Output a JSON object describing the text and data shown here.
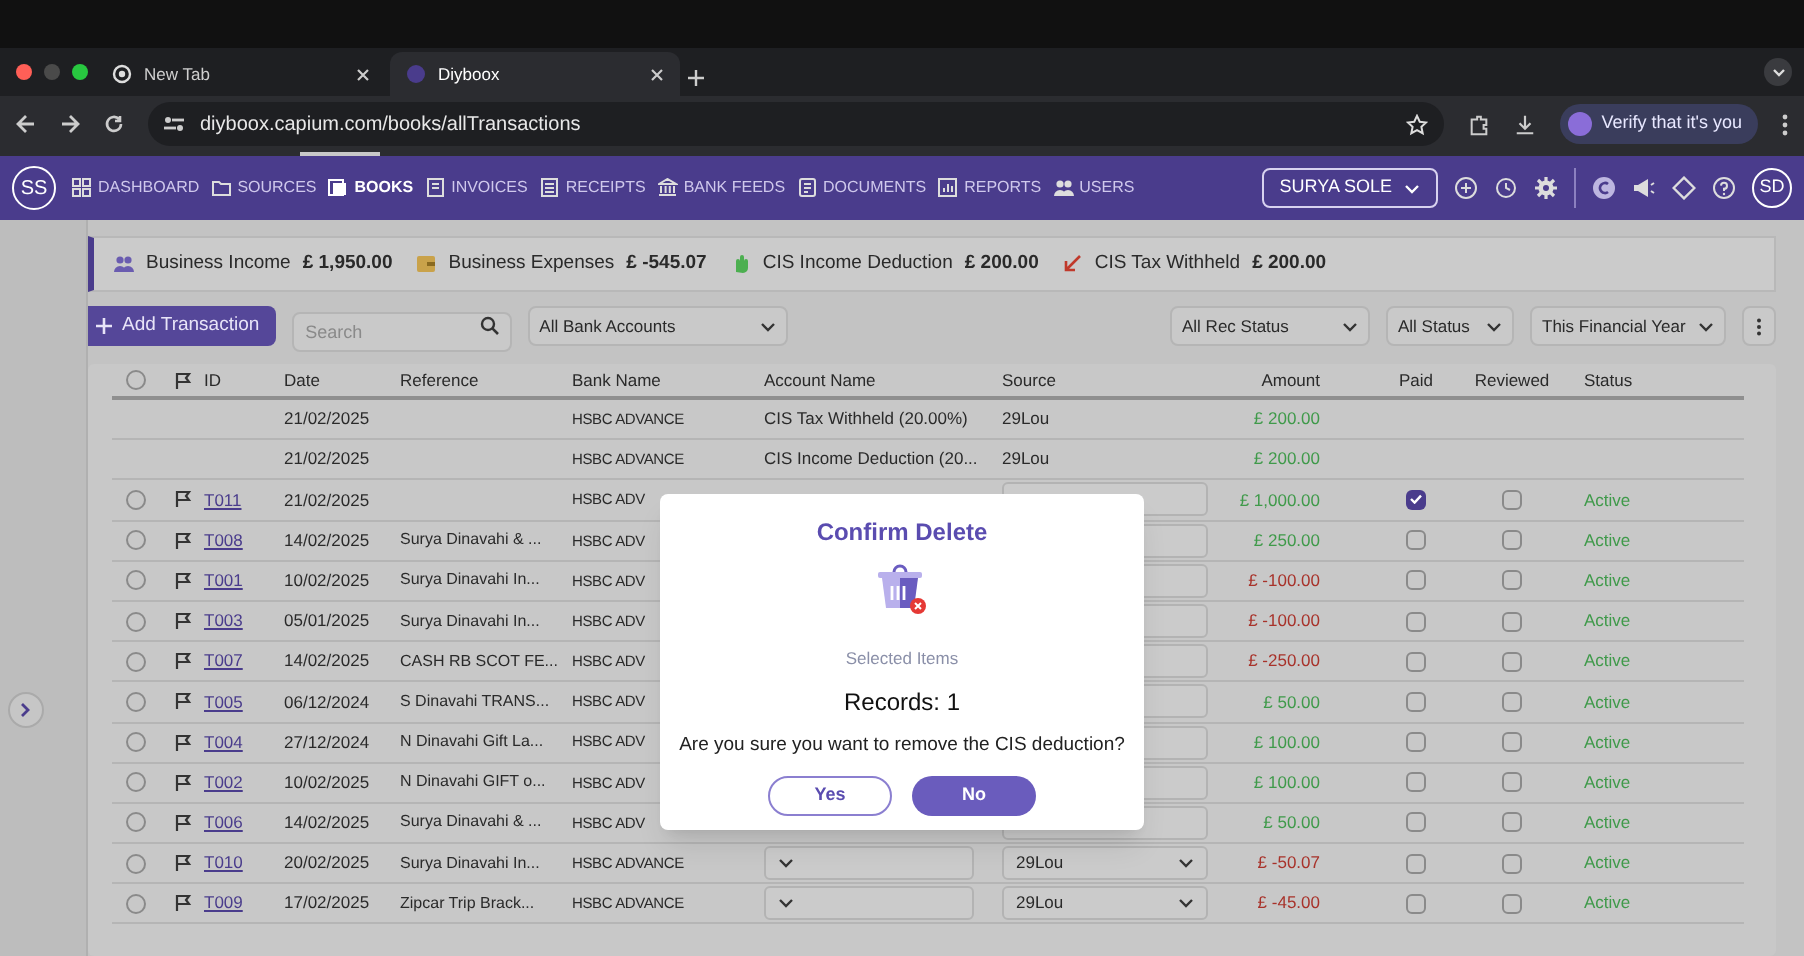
{
  "browser": {
    "tabs": [
      {
        "title": "New Tab",
        "selected": false
      },
      {
        "title": "Diyboox",
        "selected": true
      }
    ],
    "url": "diyboox.capium.com/books/allTransactions",
    "verify_button": "Verify that it's you"
  },
  "nav": {
    "logo": "SS",
    "items": [
      {
        "label": "DASHBOARD",
        "selected": false
      },
      {
        "label": "SOURCES",
        "selected": false
      },
      {
        "label": "BOOKS",
        "selected": true
      },
      {
        "label": "INVOICES",
        "selected": false
      },
      {
        "label": "RECEIPTS",
        "selected": false
      },
      {
        "label": "BANK FEEDS",
        "selected": false
      },
      {
        "label": "DOCUMENTS",
        "selected": false
      },
      {
        "label": "REPORTS",
        "selected": false
      },
      {
        "label": "USERS",
        "selected": false
      }
    ],
    "company": "SURYA SOLE",
    "avatar": "SD"
  },
  "summary": [
    {
      "kind": "income",
      "label": "Business Income",
      "value": "£ 1,950.00"
    },
    {
      "kind": "expenses",
      "label": "Business Expenses",
      "value": "£ -545.07"
    },
    {
      "kind": "cis_deduction",
      "label": "CIS Income Deduction",
      "value": "£ 200.00"
    },
    {
      "kind": "cis_withheld",
      "label": "CIS Tax Withheld",
      "value": "£ 200.00"
    }
  ],
  "toolbar": {
    "add_button": "Add Transaction",
    "search": {
      "placeholder": "Search"
    },
    "filters": [
      "All Bank Accounts",
      "All Rec Status",
      "All Status",
      "This Financial Year"
    ]
  },
  "table": {
    "select_all": false,
    "columns": [
      "ID",
      "Date",
      "Reference",
      "Bank Name",
      "Account Name",
      "Source",
      "Amount",
      "Paid",
      "Reviewed",
      "Status"
    ],
    "rows": [
      {
        "kind": "cis",
        "date": "21/02/2025",
        "bank": "HSBC ADVANCE",
        "account": {
          "kind": "text",
          "value": "CIS Tax Withheld (20.00%)"
        },
        "source": {
          "kind": "text",
          "value": "29Lou"
        },
        "amount": "£ 200.00",
        "negative": false
      },
      {
        "kind": "cis",
        "date": "21/02/2025",
        "bank": "HSBC ADVANCE",
        "account": {
          "kind": "text",
          "value": "CIS Income Deduction (20..."
        },
        "source": {
          "kind": "text",
          "value": "29Lou"
        },
        "amount": "£ 200.00",
        "negative": false
      },
      {
        "kind": "transaction",
        "id": "T011",
        "selected": false,
        "date": "21/02/2025",
        "bank": "HSBC ADV",
        "source": {
          "kind": "dropdown"
        },
        "amount": "£ 1,000.00",
        "negative": false,
        "paid": true,
        "reviewed": false,
        "status": "Active"
      },
      {
        "kind": "transaction",
        "id": "T008",
        "selected": false,
        "date": "14/02/2025",
        "reference": "Surya Dinavahi & ...",
        "bank": "HSBC ADV",
        "source": {
          "kind": "dropdown"
        },
        "amount": "£ 250.00",
        "negative": false,
        "paid": false,
        "reviewed": false,
        "status": "Active"
      },
      {
        "kind": "transaction",
        "id": "T001",
        "selected": false,
        "date": "10/02/2025",
        "reference": "Surya Dinavahi In...",
        "bank": "HSBC ADV",
        "source": {
          "kind": "dropdown"
        },
        "amount": "£ -100.00",
        "negative": true,
        "paid": false,
        "reviewed": false,
        "status": "Active"
      },
      {
        "kind": "transaction",
        "id": "T003",
        "selected": false,
        "date": "05/01/2025",
        "reference": "Surya Dinavahi In...",
        "bank": "HSBC ADV",
        "source": {
          "kind": "dropdown"
        },
        "amount": "£ -100.00",
        "negative": true,
        "paid": false,
        "reviewed": false,
        "status": "Active"
      },
      {
        "kind": "transaction",
        "id": "T007",
        "selected": false,
        "date": "14/02/2025",
        "reference": "CASH RB SCOT FE...",
        "bank": "HSBC ADV",
        "source": {
          "kind": "dropdown"
        },
        "amount": "£ -250.00",
        "negative": true,
        "paid": false,
        "reviewed": false,
        "status": "Active"
      },
      {
        "kind": "transaction",
        "id": "T005",
        "selected": false,
        "date": "06/12/2024",
        "reference": "S Dinavahi TRANS...",
        "bank": "HSBC ADV",
        "source": {
          "kind": "dropdown"
        },
        "amount": "£ 50.00",
        "negative": false,
        "paid": false,
        "reviewed": false,
        "status": "Active"
      },
      {
        "kind": "transaction",
        "id": "T004",
        "selected": false,
        "date": "27/12/2024",
        "reference": "N Dinavahi Gift La...",
        "bank": "HSBC ADV",
        "source": {
          "kind": "dropdown"
        },
        "amount": "£ 100.00",
        "negative": false,
        "paid": false,
        "reviewed": false,
        "status": "Active"
      },
      {
        "kind": "transaction",
        "id": "T002",
        "selected": false,
        "date": "10/02/2025",
        "reference": "N Dinavahi GIFT o...",
        "bank": "HSBC ADV",
        "source": {
          "kind": "dropdown"
        },
        "amount": "£ 100.00",
        "negative": false,
        "paid": false,
        "reviewed": false,
        "status": "Active"
      },
      {
        "kind": "transaction",
        "id": "T006",
        "selected": false,
        "date": "14/02/2025",
        "reference": "Surya Dinavahi & ...",
        "bank": "HSBC ADV",
        "source": {
          "kind": "dropdown"
        },
        "amount": "£ 50.00",
        "negative": false,
        "paid": false,
        "reviewed": false,
        "status": "Active"
      },
      {
        "kind": "transaction",
        "id": "T010",
        "selected": false,
        "date": "20/02/2025",
        "reference": "Surya Dinavahi In...",
        "bank": "HSBC ADVANCE",
        "account": {
          "kind": "dropdown"
        },
        "source": {
          "kind": "dropdown",
          "value": "29Lou"
        },
        "amount": "£ -50.07",
        "negative": true,
        "paid": false,
        "reviewed": false,
        "status": "Active"
      },
      {
        "kind": "transaction",
        "id": "T009",
        "selected": false,
        "date": "17/02/2025",
        "reference": "Zipcar Trip Brack...",
        "bank": "HSBC ADVANCE",
        "account": {
          "kind": "dropdown"
        },
        "source": {
          "kind": "dropdown",
          "value": "29Lou"
        },
        "amount": "£ -45.00",
        "negative": true,
        "paid": false,
        "reviewed": false,
        "status": "Active"
      }
    ]
  },
  "modal": {
    "title": "Confirm Delete",
    "subtitle": "Selected Items",
    "records": "Records: 1",
    "message": "Are you sure you want to remove the CIS deduction?",
    "buttons": [
      {
        "label": "Yes",
        "primary": false
      },
      {
        "label": "No",
        "primary": true
      }
    ]
  }
}
